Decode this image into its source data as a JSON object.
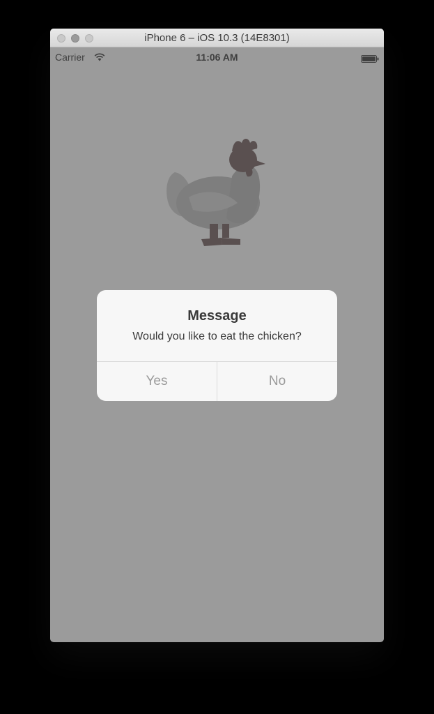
{
  "window": {
    "title": "iPhone 6 – iOS 10.3 (14E8301)"
  },
  "statusbar": {
    "carrier": "Carrier",
    "time": "11:06 AM",
    "wifi_icon": "wifi-icon",
    "battery_icon": "battery-icon"
  },
  "content": {
    "image_icon": "chicken-icon"
  },
  "alert": {
    "title": "Message",
    "message": "Would you like to eat the chicken?",
    "buttons": [
      {
        "label": "Yes"
      },
      {
        "label": "No"
      }
    ]
  },
  "colors": {
    "screen_dim": "#9b9b9b",
    "alert_bg": "#f7f7f7",
    "button_text": "#9a9a9a",
    "chicken_body": "#7d7d7d",
    "chicken_dark": "#5a5050"
  }
}
